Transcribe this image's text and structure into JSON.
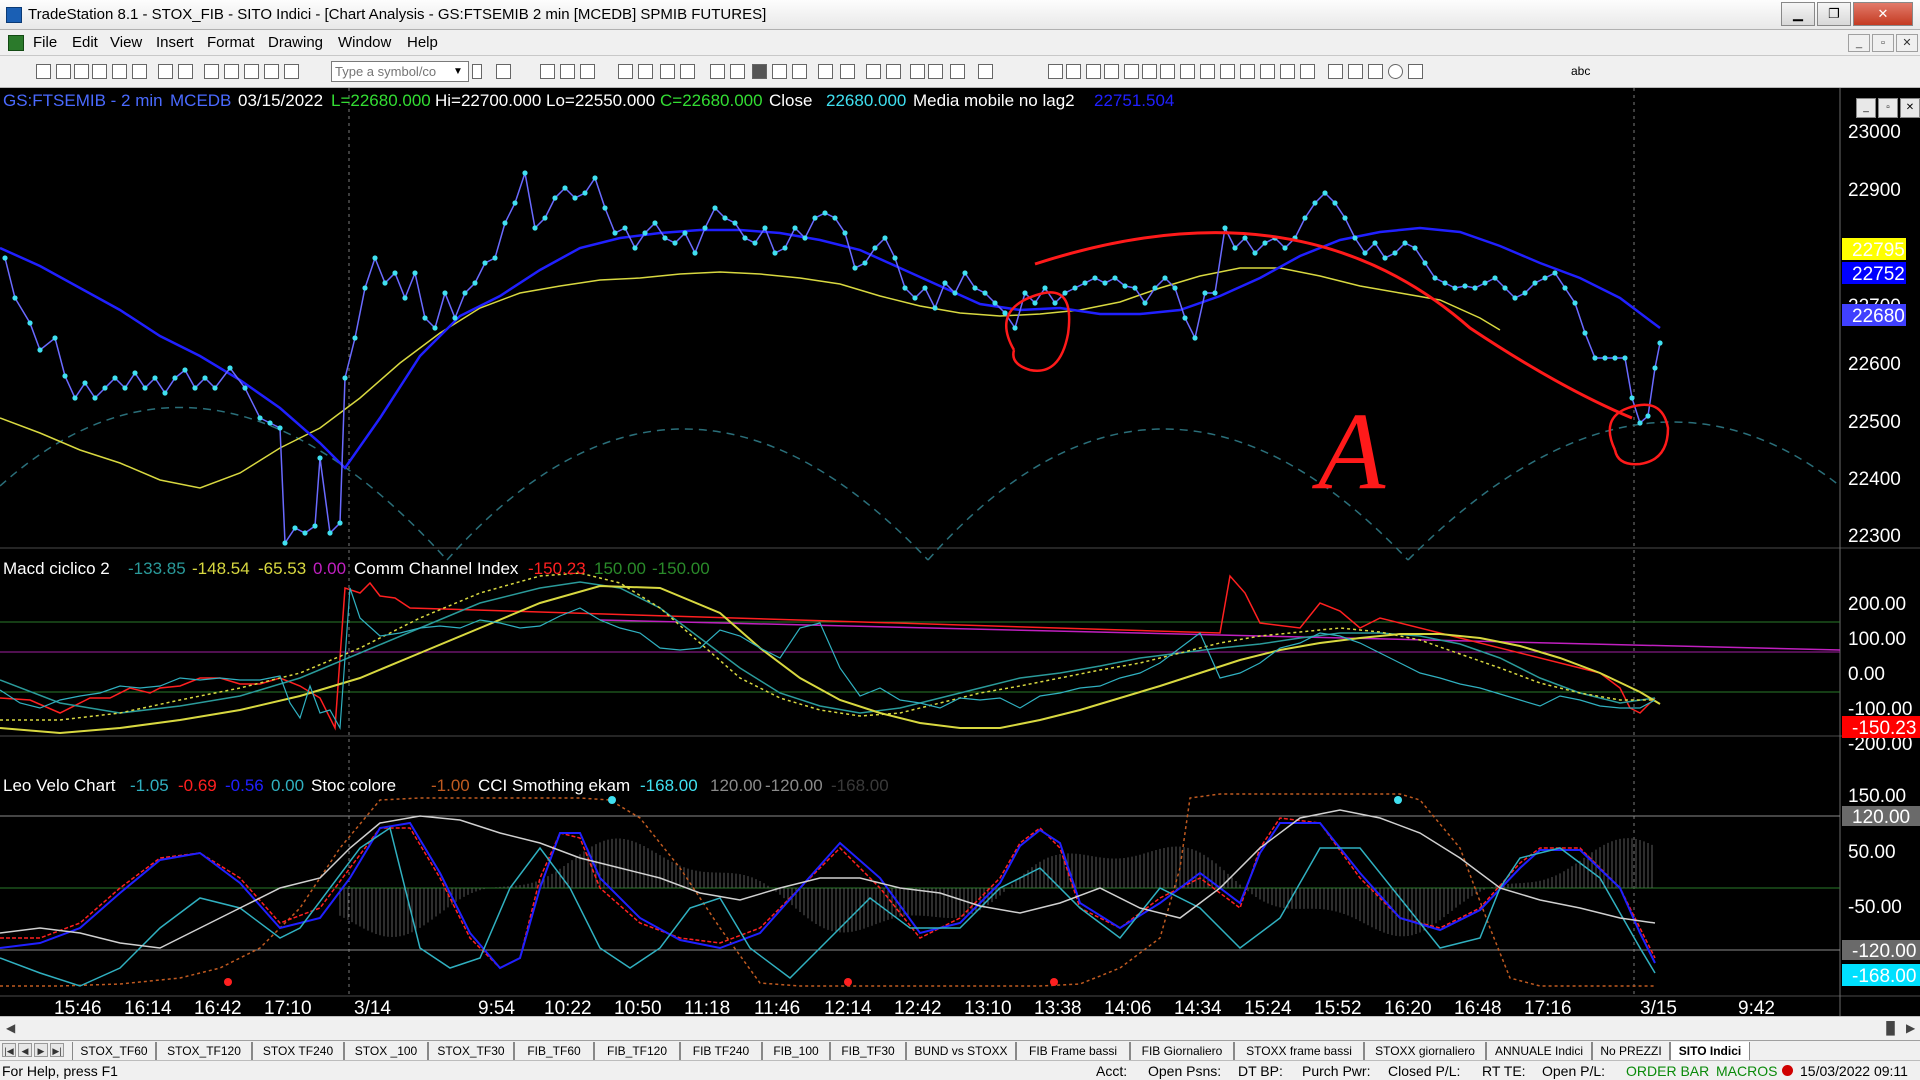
{
  "window": {
    "title": "TradeStation 8.1 - STOX_FIB - SITO Indici - [Chart Analysis - GS:FTSEMIB  2 min  [MCEDB] SPMIB FUTURES]",
    "buttons": {
      "minimize": "▁",
      "restore": "❐",
      "close": "✕"
    }
  },
  "menu": {
    "items": [
      "File",
      "Edit",
      "View",
      "Insert",
      "Format",
      "Drawing",
      "Window",
      "Help"
    ],
    "mdi_buttons": [
      "_",
      "▫",
      "✕"
    ]
  },
  "toolbar": {
    "symbol_placeholder": "Type a symbol/co",
    "text_tool": "abc"
  },
  "chart": {
    "header": {
      "symbol": "GS:FTSEMIB - 2 min",
      "exchange": "MCEDB",
      "date": "03/15/2022",
      "last": "L=22680.000",
      "high": "Hi=22700.000",
      "low": "Lo=22550.000",
      "close_val": "C=22680.000",
      "close_label": "Close",
      "close_value": "22680.000",
      "ma_label": "Media mobile no lag2",
      "ma_value": "22751.504"
    },
    "colors": {
      "background": "#000000",
      "price_dots": "#40e0f0",
      "price_line": "#6a6aff",
      "ma_fast": "#d8d840",
      "ma_slow": "#2020ff",
      "annotation": "#ff1a1a",
      "cycle_dashed": "#2a6f7a"
    },
    "price_axis": [
      "23000",
      "22900",
      "22800",
      "22700",
      "22600",
      "22500",
      "22400",
      "22300"
    ],
    "price_tags": [
      {
        "text": "22795",
        "bg": "#ffff00",
        "fg": "#000000"
      },
      {
        "text": "22752",
        "bg": "#0000ff",
        "fg": "#5050ff"
      },
      {
        "text": "22680",
        "bg": "#4040ff",
        "fg": "#ffffff"
      }
    ],
    "annotation_text": "A",
    "macd_panel": {
      "name": "Macd ciclico 2",
      "v1": "-133.85",
      "v2": "-148.54",
      "v3": "-65.53",
      "v4": "0.00",
      "cci_name": "Comm Channel Index",
      "cci_v": "-150.23",
      "cci_hi": "150.00",
      "cci_lo": "-150.00",
      "axis": [
        "200.00",
        "100.00",
        "0.00",
        "-100.00",
        "-200.00"
      ],
      "tag": "-150.23"
    },
    "leo_panel": {
      "name": "Leo Velo Chart",
      "v1": "-1.05",
      "v2": "-0.69",
      "v3": "-0.56",
      "v4": "0.00",
      "stoc_name": "Stoc colore",
      "stoc_v": "-1.00",
      "cci2_name": "CCI Smothing ekam",
      "cci2_v": "-168.00",
      "cci2_hi": "120.00",
      "cci2_lo": "-120.00",
      "cci2_x": "-168.00",
      "axis": [
        "150.00",
        "120.00",
        "50.00",
        "-50.00",
        "-120.00",
        "-168.00"
      ]
    },
    "time_axis": [
      "15:46",
      "16:14",
      "16:42",
      "17:10",
      "3/14",
      "9:54",
      "10:22",
      "10:50",
      "11:18",
      "11:46",
      "12:14",
      "12:42",
      "13:10",
      "13:38",
      "14:06",
      "14:34",
      "15:24",
      "15:52",
      "16:20",
      "16:48",
      "17:16",
      "3/15",
      "9:42"
    ]
  },
  "tabs": [
    "STOX_TF60",
    "STOX_TF120",
    "STOX TF240",
    "STOX _100",
    "STOX_TF30",
    "FIB_TF60",
    "FIB_TF120",
    "FIB TF240",
    "FIB_100",
    "FIB_TF30",
    "BUND vs STOXX",
    "FIB Frame bassi",
    "FIB Giornaliero",
    "STOXX frame bassi",
    "STOXX giornaliero",
    "ANNUALE Indici",
    "No PREZZI",
    "SITO Indici"
  ],
  "active_tab": "SITO Indici",
  "status": {
    "help": "For Help, press F1",
    "acct": "Acct:",
    "open_psns": "Open Psns:",
    "dt_bp": "DT BP:",
    "purch_pwr": "Purch Pwr:",
    "closed_pl": "Closed P/L:",
    "rt_te": "RT TE:",
    "open_pl": "Open P/L:",
    "order_bar": "ORDER BAR",
    "macros": "MACROS",
    "datetime": "15/03/2022 09:11"
  }
}
